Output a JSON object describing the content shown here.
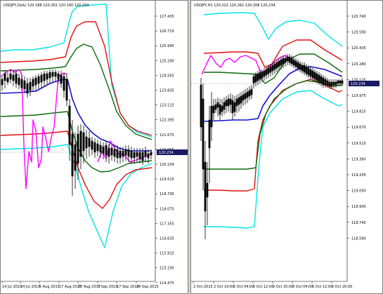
{
  "colors": {
    "outer": "#00e5e5",
    "band2": "#e01010",
    "band1": "#0a6a0a",
    "mid": "#1010cc",
    "magenta": "#ff00ff",
    "price": "#000000",
    "current_tag": "#1a1a66"
  },
  "left_chart": {
    "title": "USDJPY,Daily  120.188 120.262 120.100 120.234",
    "price_labels": [
      "127.435",
      "126.715",
      "125.995",
      "125.290",
      "124.555",
      "123.835",
      "123.115",
      "122.395",
      "121.675",
      "120.955",
      "120.234",
      "119.515",
      "118.795",
      "118.075",
      "117.355",
      "116.635",
      "115.915",
      "115.195",
      "114.475"
    ],
    "time_labels": [
      "14 Jul 2015",
      "24 Jul 2015",
      "5 Aug 2015",
      "17 Aug 2015",
      "27 Aug 2015",
      "7 Sep 2015",
      "17 Sep 2015",
      "29 Sep 2015"
    ],
    "current_price": "120.234"
  },
  "right_chart": {
    "title": "USDJPY,H1  120.222 120.262 120.208 120.234",
    "price_labels": [
      "120.740",
      "120.590",
      "120.435",
      "120.280",
      "120.125",
      "119.975",
      "119.825",
      "119.670",
      "119.515",
      "119.360",
      "119.205",
      "119.050",
      "118.900",
      "118.745",
      "118.590"
    ],
    "time_labels": [
      "2 Oct 2015",
      "2 Oct 19:00",
      "5 Oct 04:00",
      "5 Oct 12:00",
      "5 Oct 20:00",
      "6 Oct 04:00",
      "6 Oct 12:00",
      "6 Oct 20:00"
    ],
    "current_price": "120.234"
  }
}
